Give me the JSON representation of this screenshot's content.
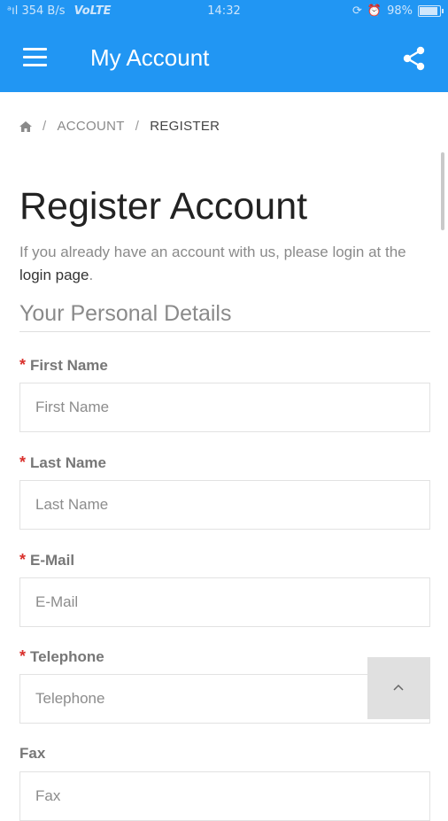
{
  "status_bar": {
    "network_speed": "354 B/s",
    "volte": "VoLTE",
    "time": "14:32",
    "battery": "98%",
    "battery_level": 0.98
  },
  "app_bar": {
    "title": "My Account",
    "menu_icon": "hamburger-menu-icon",
    "share_icon": "share-icon"
  },
  "breadcrumb": {
    "home_icon": "home-icon",
    "items": [
      "ACCOUNT",
      "REGISTER"
    ]
  },
  "page": {
    "title": "Register Account",
    "intro_prefix": "If you already have an account with us, please login at the ",
    "intro_link": "login page",
    "intro_suffix": ".",
    "section_title": "Your Personal Details"
  },
  "form": {
    "fields": [
      {
        "label": "First Name",
        "placeholder": "First Name",
        "required": true
      },
      {
        "label": "Last Name",
        "placeholder": "Last Name",
        "required": true
      },
      {
        "label": "E-Mail",
        "placeholder": "E-Mail",
        "required": true
      },
      {
        "label": "Telephone",
        "placeholder": "Telephone",
        "required": true
      },
      {
        "label": "Fax",
        "placeholder": "Fax",
        "required": false
      }
    ],
    "required_mark": "*"
  },
  "back_to_top_icon": "chevron-up-icon",
  "colors": {
    "primary": "#2196f3",
    "required": "#d9302c"
  }
}
